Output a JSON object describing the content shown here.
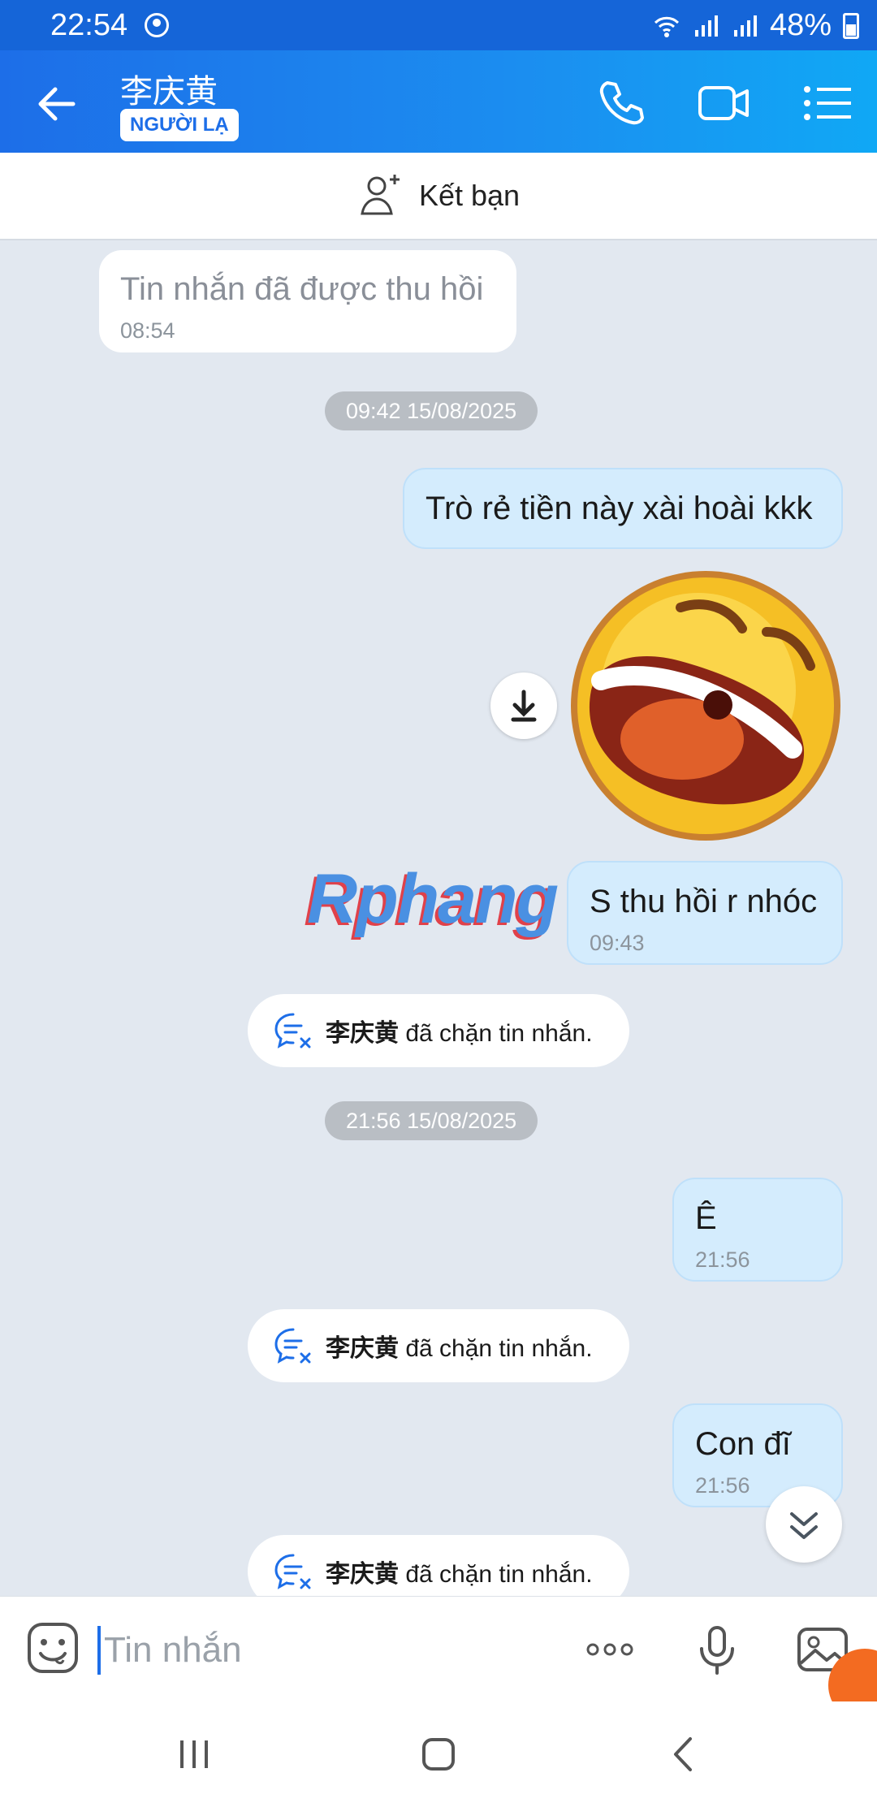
{
  "status_bar": {
    "time": "22:54",
    "battery": "48%"
  },
  "header": {
    "name": "李庆黄",
    "badge": "NGƯỜI LẠ"
  },
  "add_friend": {
    "label": "Kết bạn"
  },
  "messages": {
    "recalled": {
      "text": "Tin nhắn đã được thu hồi",
      "time": "08:54"
    },
    "date1": "09:42 15/08/2025",
    "out1": {
      "text": "Trò rẻ tiền này xài hoài kkk"
    },
    "out2": {
      "text": "S thu hồi r nhóc",
      "time": "09:43"
    },
    "notice_who": "李庆黄",
    "notice_text": "đã chặn tin nhắn.",
    "date2": "21:56 15/08/2025",
    "out3": {
      "text": "Ê",
      "time": "21:56"
    },
    "out4": {
      "text": "Con đĩ",
      "time": "21:56"
    }
  },
  "watermark": "Rphang",
  "input": {
    "placeholder": "Tin nhắn"
  },
  "colors": {
    "header_blue": "#1d6ee8",
    "bubble_out": "#d4ecfd",
    "chat_bg": "#e2e8f0"
  }
}
